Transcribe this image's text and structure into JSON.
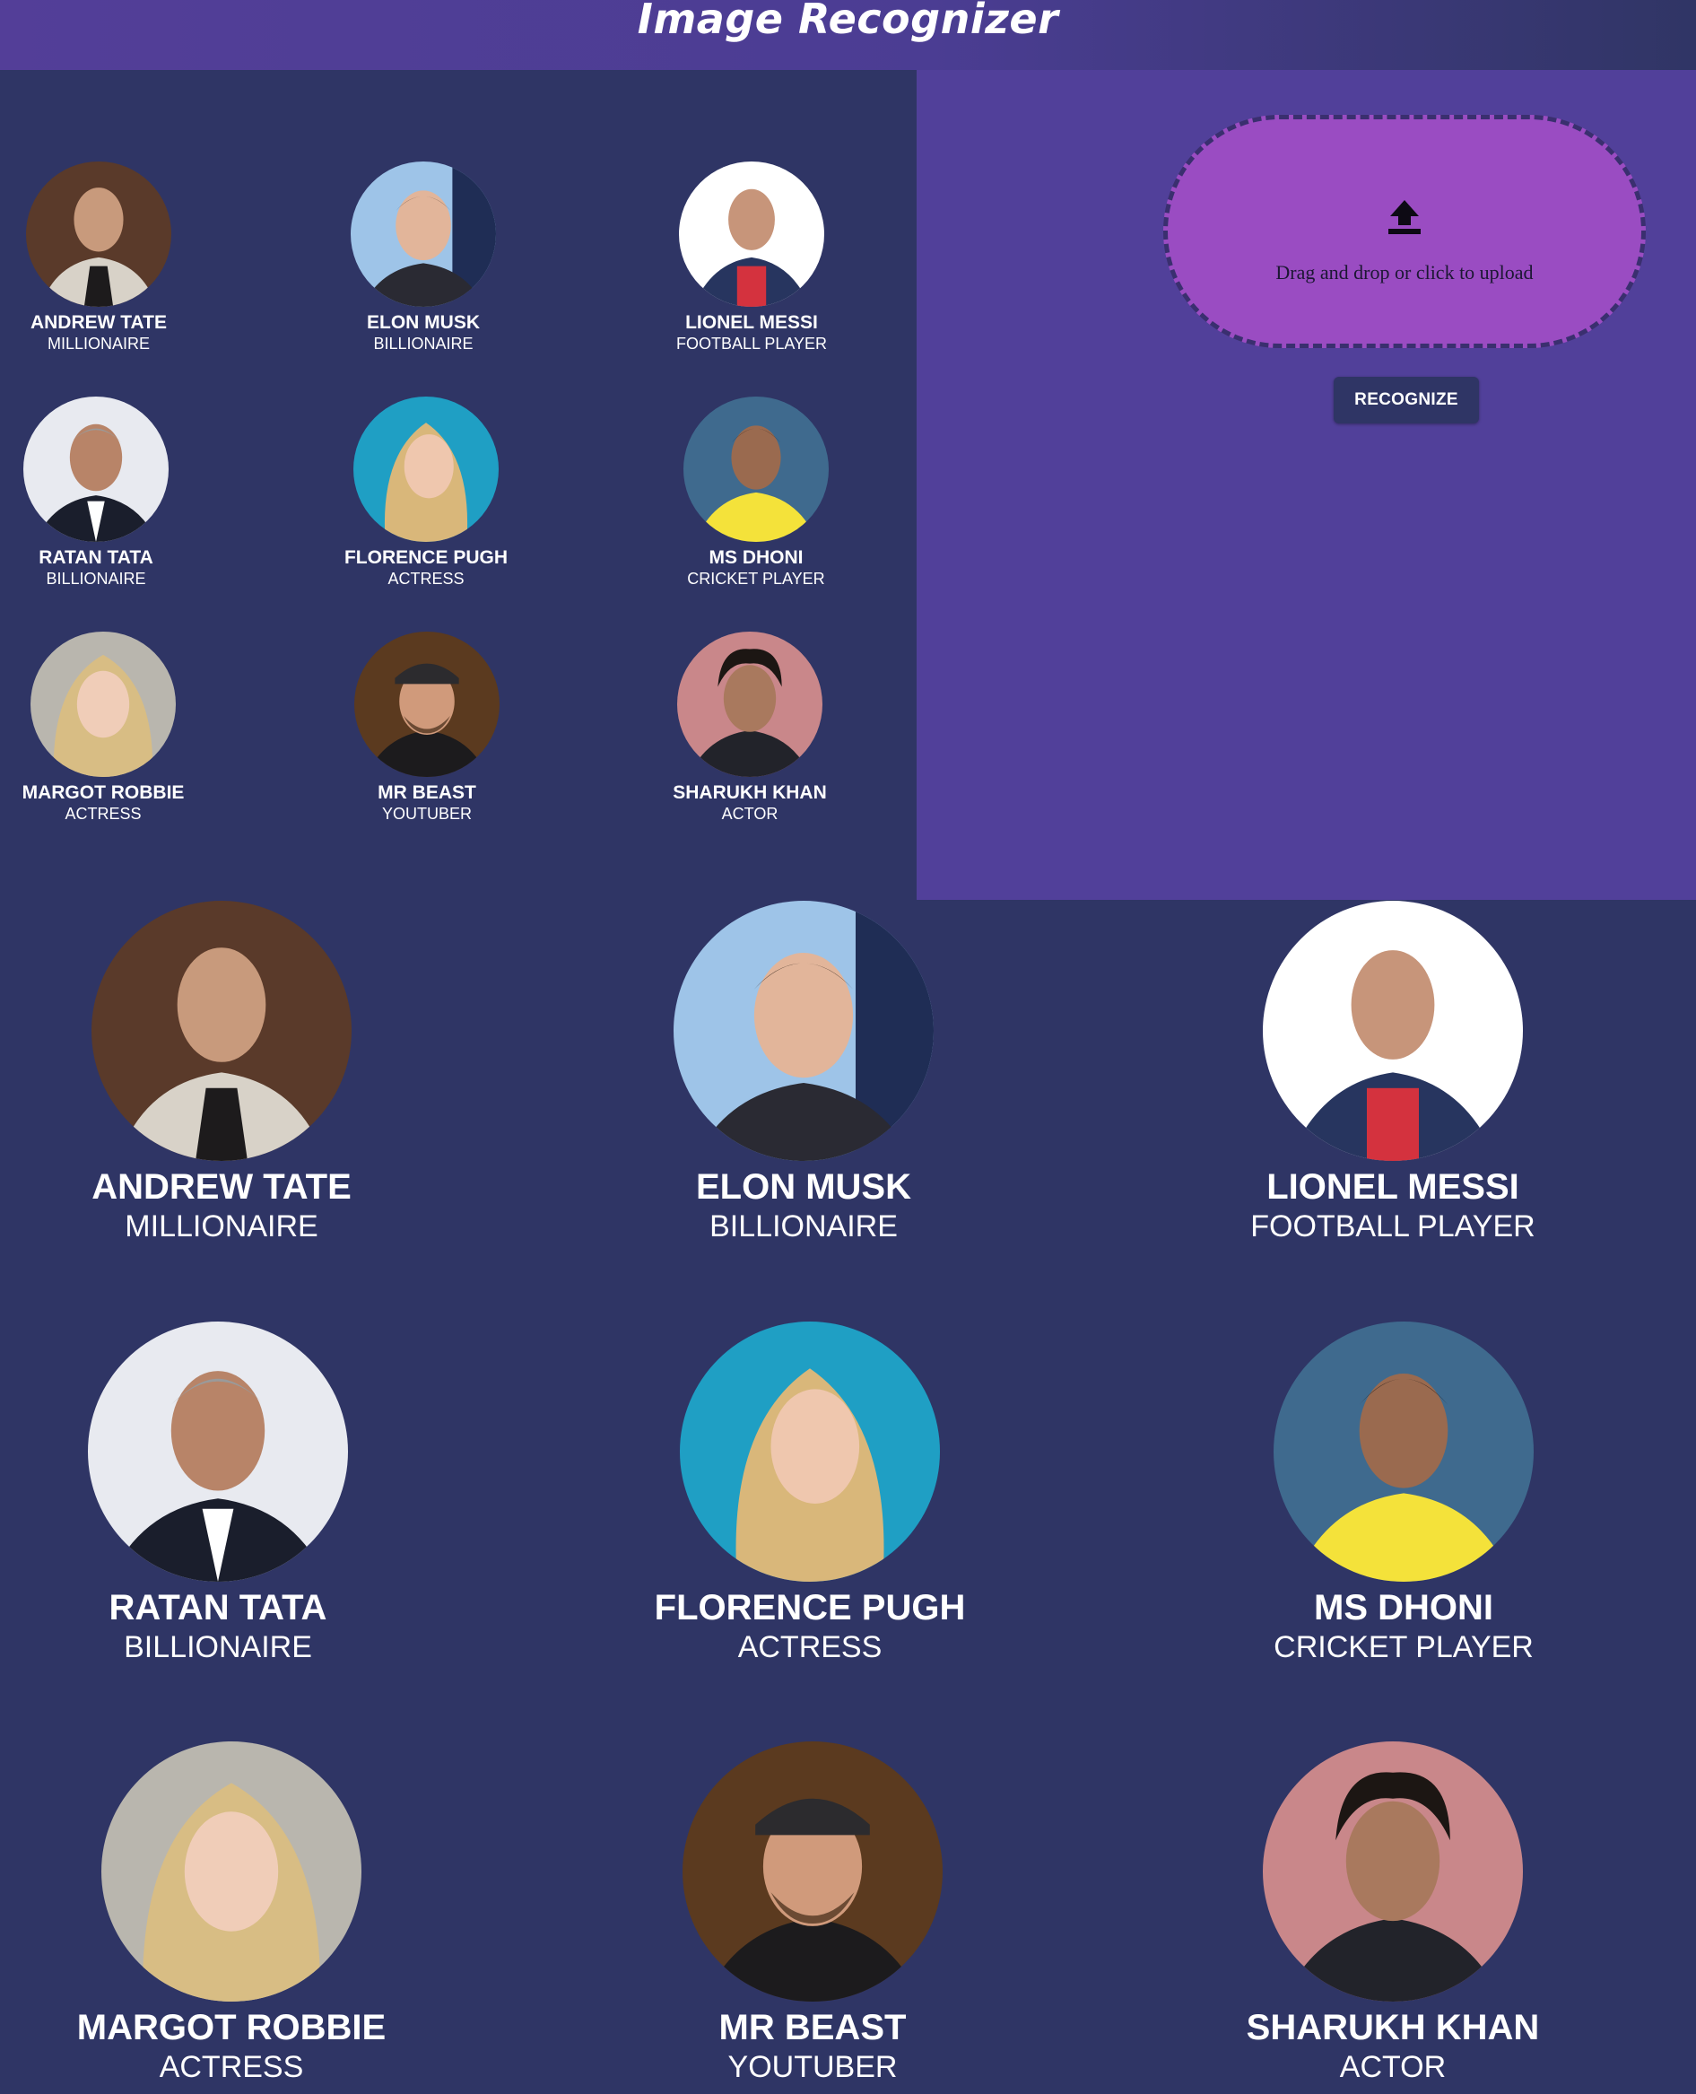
{
  "header": {
    "title": "Image Recognizer"
  },
  "upload": {
    "icon": "upload-icon",
    "text": "Drag and drop or click to upload",
    "button_label": "RECOGNIZE"
  },
  "people": [
    {
      "name": "ANDREW TATE",
      "role": "MILLIONAIRE"
    },
    {
      "name": "ELON MUSK",
      "role": "BILLIONAIRE"
    },
    {
      "name": "LIONEL MESSI",
      "role": "FOOTBALL PLAYER"
    },
    {
      "name": "RATAN TATA",
      "role": "BILLIONAIRE"
    },
    {
      "name": "FLORENCE PUGH",
      "role": "ACTRESS"
    },
    {
      "name": "MS DHONI",
      "role": "CRICKET PLAYER"
    },
    {
      "name": "MARGOT ROBBIE",
      "role": "ACTRESS"
    },
    {
      "name": "MR BEAST",
      "role": "YOUTUBER"
    },
    {
      "name": "SHARUKH KHAN",
      "role": "ACTOR"
    }
  ],
  "colors": {
    "background": "#2f3565",
    "header": "#533e98",
    "panel": "#51409a",
    "dropzone": "#9a4cc2"
  }
}
